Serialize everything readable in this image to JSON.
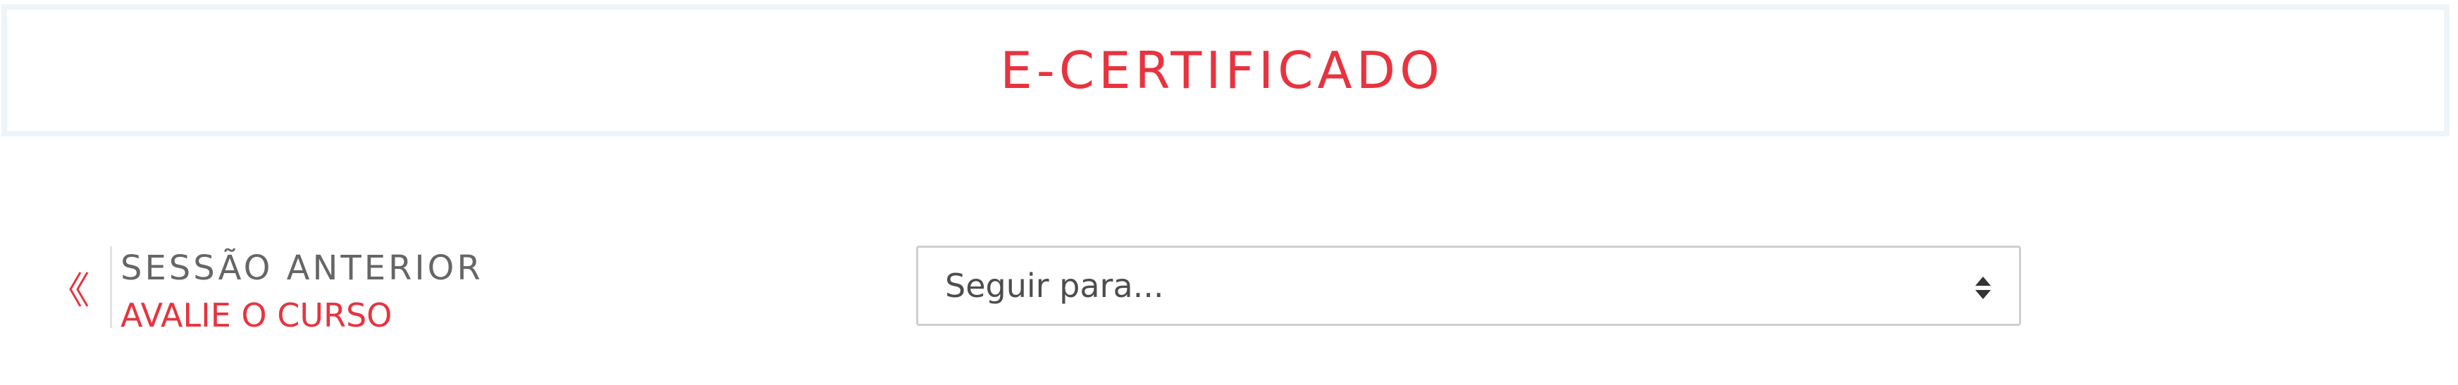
{
  "header": {
    "title": "E-CERTIFICADO"
  },
  "nav": {
    "previous_label": "SESSÃO ANTERIOR",
    "previous_link": "AVALIE O CURSO",
    "previous_icon": "double-chevron-left-icon"
  },
  "jump_menu": {
    "selected": "Seguir para...",
    "icon": "sort-arrows-icon"
  },
  "colors": {
    "accent": "#e8333f",
    "muted_text": "#666666",
    "border": "#cfcfcf",
    "title_border": "#eef5fa"
  }
}
